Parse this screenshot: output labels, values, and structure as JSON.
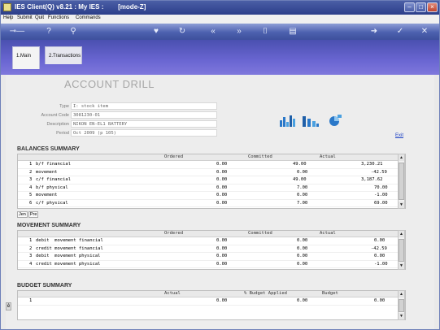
{
  "window": {
    "title": "IES Client(Q) v8.21 : My IES :        [mode-Z]",
    "controls": [
      "minimize-icon",
      "maximize-icon",
      "close-icon"
    ]
  },
  "menu": [
    "Help",
    "Submit",
    "Quit",
    "Functions",
    "Commands"
  ],
  "toolbar_icons": [
    "key-icon",
    "help-icon",
    "search-icon",
    "heart-icon",
    "refresh-icon",
    "rewind-icon",
    "fast-forward-icon",
    "bookmark-icon",
    "clipboard-icon",
    "forward-icon",
    "check-icon",
    "close-icon"
  ],
  "tabs": [
    {
      "label": "1.Main",
      "active": true
    },
    {
      "label": "2.Transactions",
      "active": false
    }
  ],
  "page_title": "ACCOUNT DRILL",
  "fields": [
    {
      "label": "Type",
      "value": "I: stock item"
    },
    {
      "label": "Account Code",
      "value": "3081230-01"
    },
    {
      "label": "Description",
      "value": "NIKON EN-EL1 BATTERY"
    },
    {
      "label": "Period",
      "value": "Oct 2009 (p 105)"
    }
  ],
  "exit_label": "Exit",
  "balances": {
    "title": "BALANCES SUMMARY",
    "columns": [
      "Ordered",
      "Committed",
      "Actual"
    ],
    "rows": [
      {
        "n": "1",
        "name": "b/f financial",
        "ordered": "0.00",
        "committed": "49.00",
        "actual": "3,230.21"
      },
      {
        "n": "2",
        "name": "movement",
        "ordered": "0.00",
        "committed": "0.00",
        "actual": "-42.59"
      },
      {
        "n": "3",
        "name": "c/f financial",
        "ordered": "0.00",
        "committed": "49.00",
        "actual": "3,187.62"
      },
      {
        "n": "4",
        "name": "b/f physical",
        "ordered": "0.00",
        "committed": "7.00",
        "actual": "70.00"
      },
      {
        "n": "5",
        "name": "movement",
        "ordered": "0.00",
        "committed": "0.00",
        "actual": "-1.00"
      },
      {
        "n": "6",
        "name": "c/f physical",
        "ordered": "0.00",
        "committed": "7.00",
        "actual": "69.00"
      }
    ],
    "pager": [
      "Jen",
      "Pre"
    ]
  },
  "movement": {
    "title": "MOVEMENT SUMMARY",
    "columns": [
      "Ordered",
      "Committed",
      "Actual"
    ],
    "rows": [
      {
        "n": "1",
        "name": "debit  movement financial",
        "ordered": "0.00",
        "committed": "0.00",
        "actual": "0.00"
      },
      {
        "n": "2",
        "name": "credit movement financial",
        "ordered": "0.00",
        "committed": "0.00",
        "actual": "-42.59"
      },
      {
        "n": "3",
        "name": "debit  movement physical",
        "ordered": "0.00",
        "committed": "0.00",
        "actual": "0.00"
      },
      {
        "n": "4",
        "name": "credit movement physical",
        "ordered": "0.00",
        "committed": "0.00",
        "actual": "-1.00"
      }
    ]
  },
  "budget": {
    "title": "BUDGET SUMMARY",
    "columns": [
      "Actual",
      "% Budget Applied",
      "Budget"
    ],
    "rows": [
      {
        "n": "1",
        "actual": "0.00",
        "applied": "0.00",
        "budget": "0.00"
      }
    ]
  }
}
